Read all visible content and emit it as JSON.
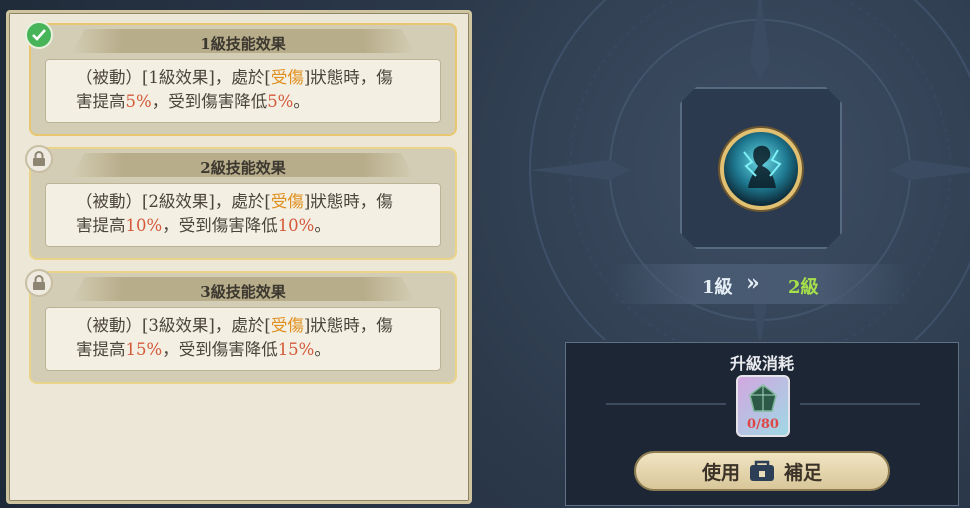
{
  "skills": [
    {
      "title": "1級技能效果",
      "status": "unlocked",
      "p1": "（被動）[1級效果]，處於[",
      "kw": "受傷",
      "p2": "]狀態時，傷",
      "p3": "害提高",
      "v1": "5%",
      "p4": "，受到傷害降低",
      "v2": "5%",
      "p5": "。"
    },
    {
      "title": "2級技能效果",
      "status": "locked",
      "p1": "（被動）[2級效果]，處於[",
      "kw": "受傷",
      "p2": "]狀態時，傷",
      "p3": "害提高",
      "v1": "10%",
      "p4": "，受到傷害降低",
      "v2": "10%",
      "p5": "。"
    },
    {
      "title": "3級技能效果",
      "status": "locked",
      "p1": "（被動）[3級效果]，處於[",
      "kw": "受傷",
      "p2": "]狀態時，傷",
      "p3": "害提高",
      "v1": "15%",
      "p4": "，受到傷害降低",
      "v2": "15%",
      "p5": "。"
    }
  ],
  "upgrade": {
    "from": "1級",
    "arrow": "»",
    "to": "2級"
  },
  "cost": {
    "title": "升級消耗",
    "item_count": "0/80",
    "use_label_1": "使用",
    "use_label_2": "補足"
  },
  "colors": {
    "highlight_orange": "#e08f1e",
    "highlight_red": "#d45a3c",
    "next_level": "#a6e04a"
  }
}
